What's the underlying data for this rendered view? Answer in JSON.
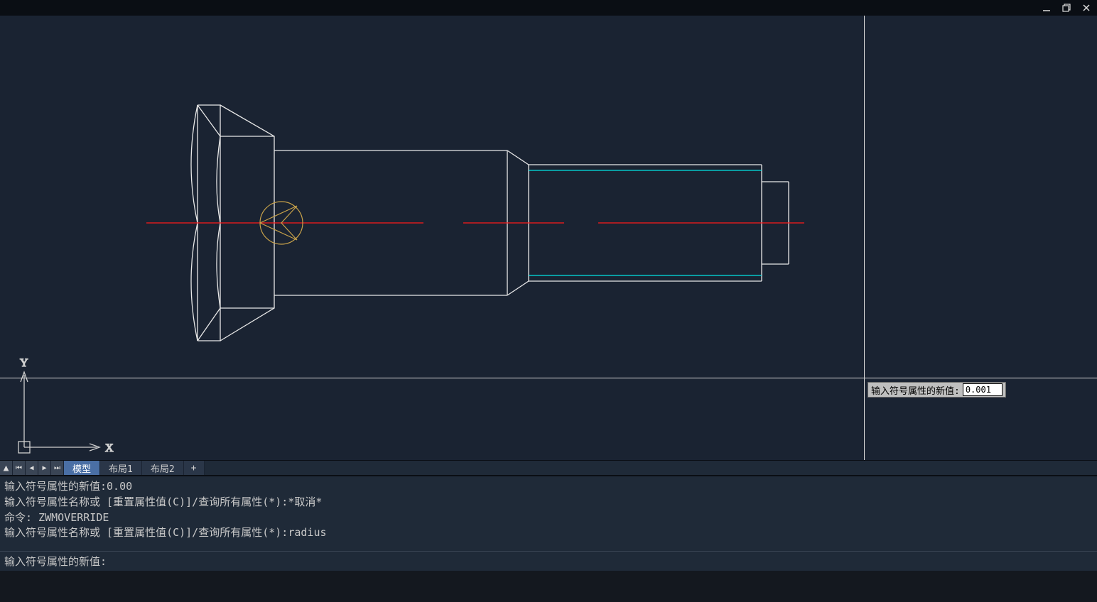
{
  "window": {
    "minimize": "–",
    "restore": "▢",
    "close": "✕"
  },
  "axes": {
    "x_label": "X",
    "y_label": "Y"
  },
  "tabs": {
    "nav_up": "▲",
    "nav_first": "⏮",
    "nav_prev": "◀",
    "nav_next": "▶",
    "nav_last": "⏭",
    "model": "模型",
    "layout1": "布局1",
    "layout2": "布局2",
    "add": "+"
  },
  "prompt": {
    "label": "输入符号属性的新值:",
    "value": "0.001"
  },
  "history": {
    "line1": "输入符号属性的新值:0.00",
    "line2": "输入符号属性名称或 [重置属性值(C)]/查询所有属性(*):*取消*",
    "line3": "命令: ZWMOVERRIDE",
    "line4": "输入符号属性名称或 [重置属性值(C)]/查询所有属性(*):radius"
  },
  "command_input": {
    "prompt": "输入符号属性的新值:",
    "value": ""
  }
}
